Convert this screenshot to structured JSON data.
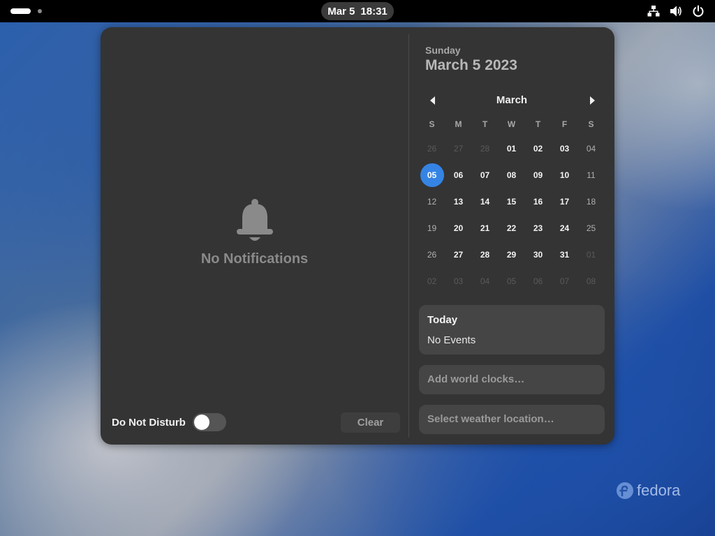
{
  "topbar": {
    "clock_date": "Mar 5",
    "clock_time": "18:31",
    "tray_icons": [
      "network-wired-icon",
      "volume-icon",
      "power-icon"
    ]
  },
  "notifications": {
    "empty_label": "No Notifications",
    "dnd_label": "Do Not Disturb",
    "dnd_enabled": false,
    "clear_label": "Clear"
  },
  "date_header": {
    "weekday": "Sunday",
    "full_date": "March 5 2023"
  },
  "calendar": {
    "month": "March",
    "weekdays": [
      "S",
      "M",
      "T",
      "W",
      "T",
      "F",
      "S"
    ],
    "today": "05",
    "weeks": [
      [
        {
          "d": "26",
          "t": "out"
        },
        {
          "d": "27",
          "t": "out"
        },
        {
          "d": "28",
          "t": "out"
        },
        {
          "d": "01",
          "t": "in"
        },
        {
          "d": "02",
          "t": "in"
        },
        {
          "d": "03",
          "t": "in"
        },
        {
          "d": "04",
          "t": "wk"
        }
      ],
      [
        {
          "d": "05",
          "t": "today"
        },
        {
          "d": "06",
          "t": "in"
        },
        {
          "d": "07",
          "t": "in"
        },
        {
          "d": "08",
          "t": "in"
        },
        {
          "d": "09",
          "t": "in"
        },
        {
          "d": "10",
          "t": "in"
        },
        {
          "d": "11",
          "t": "wk"
        }
      ],
      [
        {
          "d": "12",
          "t": "wk"
        },
        {
          "d": "13",
          "t": "in"
        },
        {
          "d": "14",
          "t": "in"
        },
        {
          "d": "15",
          "t": "in"
        },
        {
          "d": "16",
          "t": "in"
        },
        {
          "d": "17",
          "t": "in"
        },
        {
          "d": "18",
          "t": "wk"
        }
      ],
      [
        {
          "d": "19",
          "t": "wk"
        },
        {
          "d": "20",
          "t": "in"
        },
        {
          "d": "21",
          "t": "in"
        },
        {
          "d": "22",
          "t": "in"
        },
        {
          "d": "23",
          "t": "in"
        },
        {
          "d": "24",
          "t": "in"
        },
        {
          "d": "25",
          "t": "wk"
        }
      ],
      [
        {
          "d": "26",
          "t": "wk"
        },
        {
          "d": "27",
          "t": "in"
        },
        {
          "d": "28",
          "t": "in"
        },
        {
          "d": "29",
          "t": "in"
        },
        {
          "d": "30",
          "t": "in"
        },
        {
          "d": "31",
          "t": "in"
        },
        {
          "d": "01",
          "t": "out"
        }
      ],
      [
        {
          "d": "02",
          "t": "out"
        },
        {
          "d": "03",
          "t": "out"
        },
        {
          "d": "04",
          "t": "out"
        },
        {
          "d": "05",
          "t": "out"
        },
        {
          "d": "06",
          "t": "out"
        },
        {
          "d": "07",
          "t": "out"
        },
        {
          "d": "08",
          "t": "out"
        }
      ]
    ]
  },
  "events": {
    "title": "Today",
    "subtitle": "No Events"
  },
  "world_clocks": {
    "hint": "Add world clocks…"
  },
  "weather": {
    "hint": "Select weather location…"
  },
  "branding": {
    "logo_text": "fedora"
  },
  "colors": {
    "accent": "#3584e4",
    "panel_bg": "#343434",
    "card_bg": "#454545"
  }
}
